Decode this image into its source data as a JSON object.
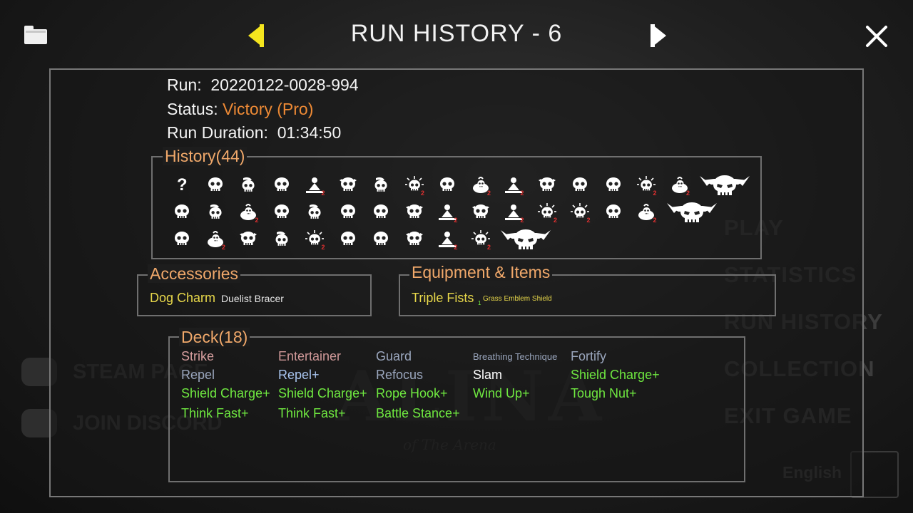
{
  "header": {
    "title": "RUN HISTORY - 6"
  },
  "run": {
    "run_label": "Run:",
    "run_id": "20220122-0028-994",
    "status_label": "Status:",
    "status_value": "Victory (Pro)",
    "duration_label": "Run Duration:",
    "duration_value": "01:34:50"
  },
  "history": {
    "title": "History(44)",
    "rows": [
      [
        "unknown-icon",
        "skull-icon",
        "skull-swirl-icon",
        "skull-icon",
        "skull-meditating-icon",
        "skull-horned-icon",
        "skull-swirl-icon",
        "skull-burst-icon",
        "skull-icon",
        "skull-pot-icon",
        "skull-meditating-icon",
        "skull-horned-icon",
        "skull-icon",
        "skull-icon",
        "skull-burst-icon",
        "skull-pot-icon",
        "boss-skull-icon"
      ],
      [
        "skull-icon",
        "skull-swirl-icon",
        "skull-pot-icon",
        "skull-icon",
        "skull-swirl-icon",
        "skull-icon",
        "skull-icon",
        "skull-horned-icon",
        "skull-meditating-icon",
        "skull-horned-icon",
        "skull-meditating-icon",
        "skull-burst-icon",
        "skull-burst-icon",
        "skull-icon",
        "skull-pot-icon",
        "boss-skull-icon"
      ],
      [
        "skull-icon",
        "skull-pot-icon",
        "skull-horned-icon",
        "skull-swirl-icon",
        "skull-burst-icon",
        "skull-icon",
        "skull-icon",
        "skull-horned-icon",
        "skull-meditating-icon",
        "skull-burst-icon",
        "boss-skull-icon"
      ]
    ]
  },
  "accessories": {
    "title": "Accessories",
    "items": [
      "Dog Charm",
      "Duelist Bracer"
    ]
  },
  "equipment": {
    "title": "Equipment & Items",
    "main": "Triple Fists",
    "sub_badge": "1",
    "secondary": "Grass Emblem Shield"
  },
  "deck": {
    "title": "Deck(18)",
    "cards": [
      {
        "name": "Strike",
        "color": "#d89f9f"
      },
      {
        "name": "Entertainer",
        "color": "#cf9898"
      },
      {
        "name": "Guard",
        "color": "#9aa6bd"
      },
      {
        "name": "Breathing Technique",
        "color": "#9aa6bd"
      },
      {
        "name": "Fortify",
        "color": "#9aa6bd"
      },
      {
        "name": "Repel",
        "color": "#9aa6bd"
      },
      {
        "name": "Repel+",
        "color": "#a8c4ee"
      },
      {
        "name": "Refocus",
        "color": "#9aa6bd"
      },
      {
        "name": "Slam",
        "color": "#ffffff"
      },
      {
        "name": "Shield Charge+",
        "color": "#6fe840"
      },
      {
        "name": "Shield Charge+",
        "color": "#6fe840"
      },
      {
        "name": "Shield Charge+",
        "color": "#6fe840"
      },
      {
        "name": "Rope Hook+",
        "color": "#6fe840"
      },
      {
        "name": "Wind Up+",
        "color": "#6fe840"
      },
      {
        "name": "Tough Nut+",
        "color": "#6fe840"
      },
      {
        "name": "Think Fast+",
        "color": "#6fe840"
      },
      {
        "name": "Think Fast+",
        "color": "#6fe840"
      },
      {
        "name": "Battle Stance+",
        "color": "#6fe840"
      }
    ]
  },
  "background_menu": {
    "items": [
      "PLAY",
      "STATISTICS",
      "RUN HISTORY",
      "COLLECTION",
      "EXIT GAME"
    ],
    "links": [
      "STEAM PAGE",
      "JOIN DISCORD"
    ],
    "language": "English"
  },
  "colors": {
    "accent_orange": "#f0a86a",
    "victory": "#ee8a35",
    "upgraded_green": "#6fe840",
    "item_gold": "#e8d84a",
    "arrow_yellow": "#f5e51e"
  }
}
